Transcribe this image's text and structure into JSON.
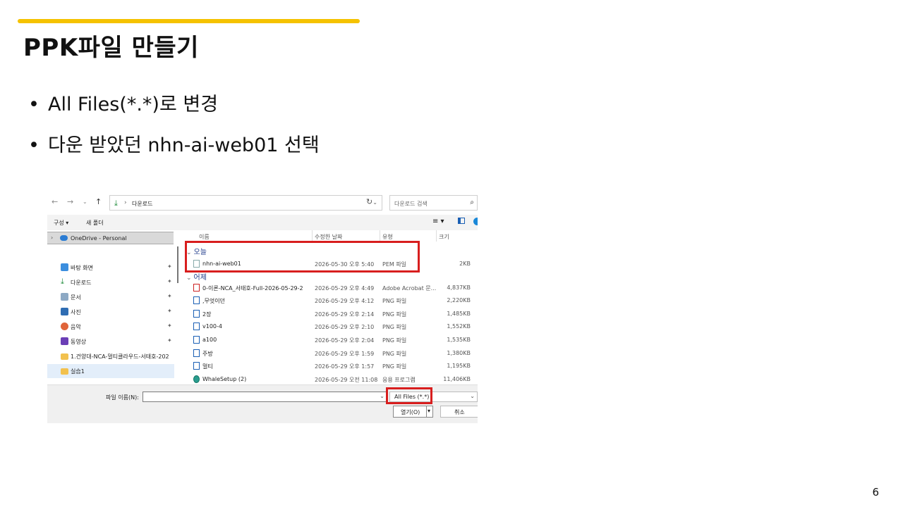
{
  "slide": {
    "title": "PPK파일 만들기",
    "bullets": [
      "All Files(*.*)로 변경",
      "다운 받았던 nhn-ai-web01 선택"
    ],
    "bullet_glyph": "•",
    "page_number": "6"
  },
  "dialog": {
    "address_path": "다운로드",
    "search_placeholder": "다운로드 검색",
    "toolbar": {
      "organize": "구성 ▾",
      "new_folder": "새 폴더"
    },
    "nav_items": [
      {
        "label": "OneDrive - Personal",
        "icon": "cloud-icon",
        "pinned": false
      },
      {
        "label": "바탕 화면",
        "icon": "desktop-icon",
        "pinned": true
      },
      {
        "label": "다운로드",
        "icon": "download-icon",
        "pinned": true
      },
      {
        "label": "문서",
        "icon": "document-icon",
        "pinned": true
      },
      {
        "label": "사진",
        "icon": "picture-icon",
        "pinned": true
      },
      {
        "label": "음악",
        "icon": "music-icon",
        "pinned": true
      },
      {
        "label": "동영상",
        "icon": "video-icon",
        "pinned": true
      },
      {
        "label": "1.건양대-NCA-멀티클라우드-서태호-202",
        "icon": "folder-icon",
        "pinned": false
      },
      {
        "label": "실습1",
        "icon": "folder-icon",
        "pinned": false
      }
    ],
    "columns": {
      "name": "이름",
      "date": "수정한 날짜",
      "type": "유형",
      "size": "크기"
    },
    "groups": {
      "today": "오늘",
      "yesterday": "어제"
    },
    "files_today": [
      {
        "name": "nhn-ai-web01",
        "date": "2026-05-30 오후 5:40",
        "type": "PEM 파일",
        "size": "2KB",
        "icon": "file-icon"
      }
    ],
    "files_yesterday": [
      {
        "name": "0-이론-NCA_서태호-Full-2026-05-29-2",
        "date": "2026-05-29 오후 4:49",
        "type": "Adobe Acrobat 문...",
        "size": "4,837KB",
        "icon": "pdf-icon"
      },
      {
        "name": ",무엇이던",
        "date": "2026-05-29 오후 4:12",
        "type": "PNG 파일",
        "size": "2,220KB",
        "icon": "image-file-icon"
      },
      {
        "name": "2장",
        "date": "2026-05-29 오후 2:14",
        "type": "PNG 파일",
        "size": "1,485KB",
        "icon": "image-file-icon"
      },
      {
        "name": "v100-4",
        "date": "2026-05-29 오후 2:10",
        "type": "PNG 파일",
        "size": "1,552KB",
        "icon": "image-file-icon"
      },
      {
        "name": "a100",
        "date": "2026-05-29 오후 2:04",
        "type": "PNG 파일",
        "size": "1,535KB",
        "icon": "image-file-icon"
      },
      {
        "name": "주방",
        "date": "2026-05-29 오후 1:59",
        "type": "PNG 파일",
        "size": "1,380KB",
        "icon": "image-file-icon"
      },
      {
        "name": "멀티",
        "date": "2026-05-29 오후 1:57",
        "type": "PNG 파일",
        "size": "1,195KB",
        "icon": "image-file-icon"
      },
      {
        "name": "WhaleSetup (2)",
        "date": "2026-05-29 오전 11:08",
        "type": "응용 프로그램",
        "size": "11,406KB",
        "icon": "app-icon"
      }
    ],
    "filename_label": "파일 이름(N):",
    "filename_value": "",
    "filter_value": "All Files (*.*)",
    "open_button": "열기(O)",
    "cancel_button": "취소",
    "colors": {
      "accent": "#f5c200",
      "highlight_box": "#d81e1e"
    }
  }
}
